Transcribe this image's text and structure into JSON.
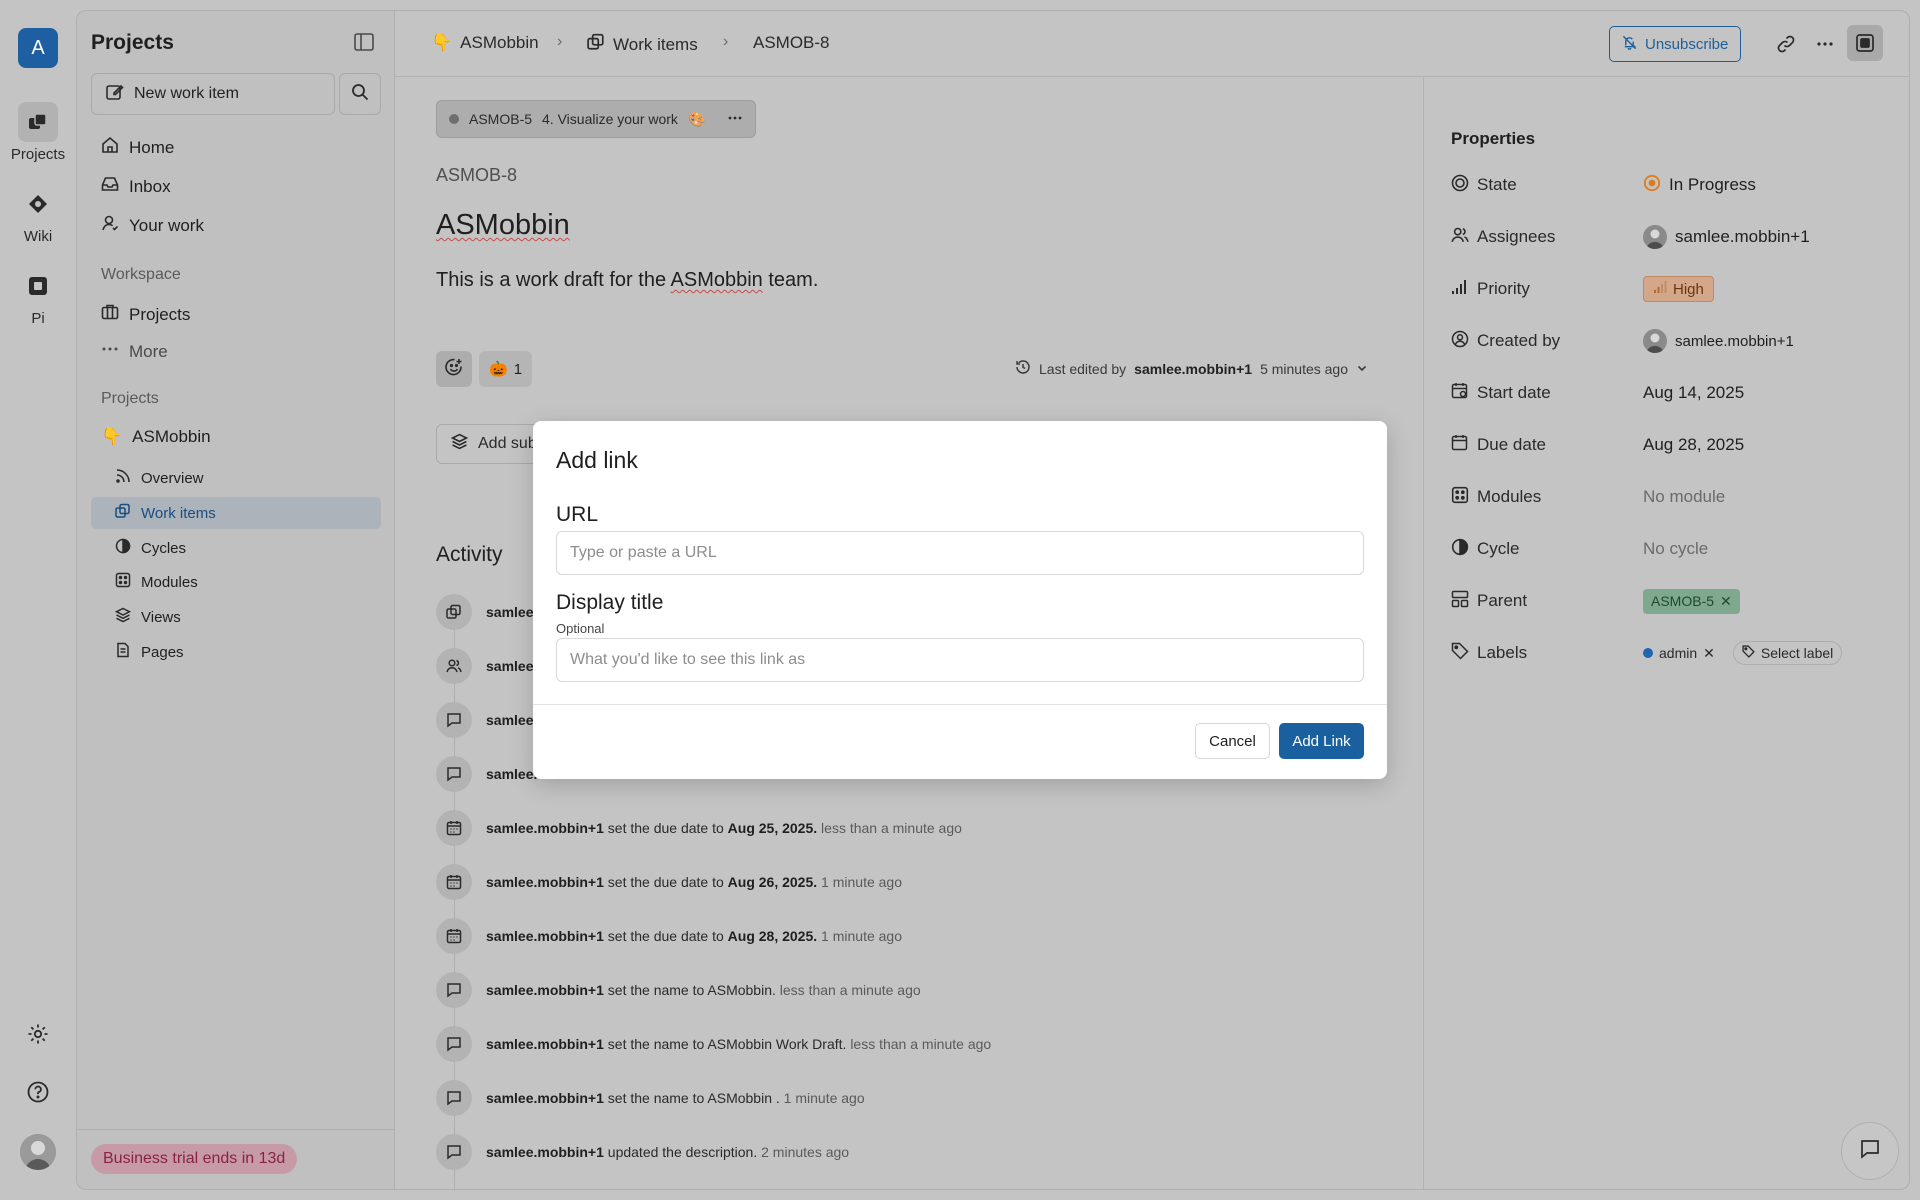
{
  "rail": {
    "workspace_initial": "A",
    "items": [
      {
        "label": "Projects",
        "icon": "projects-icon",
        "active": true
      },
      {
        "label": "Wiki",
        "icon": "wiki-icon"
      },
      {
        "label": "Pi",
        "icon": "pi-icon"
      }
    ]
  },
  "sidebar": {
    "title": "Projects",
    "new_item_label": "New work item",
    "nav": [
      {
        "label": "Home",
        "icon": "home-icon"
      },
      {
        "label": "Inbox",
        "icon": "inbox-icon"
      },
      {
        "label": "Your work",
        "icon": "user-icon"
      }
    ],
    "workspace_heading": "Workspace",
    "workspace_items": [
      {
        "label": "Projects",
        "icon": "briefcase-icon"
      },
      {
        "label": "More",
        "icon": "more-icon"
      }
    ],
    "projects_heading": "Projects",
    "project_name": "ASMobbin",
    "project_emoji": "👇",
    "project_items": [
      {
        "label": "Overview",
        "icon": "rss-icon"
      },
      {
        "label": "Work items",
        "icon": "layers-icon",
        "active": true
      },
      {
        "label": "Cycles",
        "icon": "cycle-icon"
      },
      {
        "label": "Modules",
        "icon": "modules-icon"
      },
      {
        "label": "Views",
        "icon": "views-icon"
      },
      {
        "label": "Pages",
        "icon": "page-icon"
      }
    ],
    "trial_badge": "Business trial ends in 13d"
  },
  "topbar": {
    "breadcrumb": [
      "ASMobbin",
      "Work items",
      "ASMOB-8"
    ],
    "unsubscribe_label": "Unsubscribe"
  },
  "issue": {
    "parent_id": "ASMOB-5",
    "parent_title": "4. Visualize your work",
    "parent_emoji": "🎨",
    "id": "ASMOB-8",
    "title": "ASMobbin",
    "description_before": "This is a work draft for the ",
    "description_highlight": "ASMobbin",
    "description_after": " team.",
    "reaction_emoji": "🎃",
    "reaction_count": "1",
    "last_edited_prefix": "Last edited by",
    "last_edited_user": "samlee.mobbin+1",
    "last_edited_time": "5 minutes ago",
    "add_sub_label": "Add sub-work item"
  },
  "activity": {
    "title": "Activity",
    "partial_rows": [
      {
        "icon": "layers-icon",
        "user": "samlee."
      },
      {
        "icon": "users-icon",
        "user": "samlee."
      },
      {
        "icon": "comment-icon",
        "user": "samlee."
      },
      {
        "icon": "comment-icon",
        "user": "samlee."
      }
    ],
    "rows": [
      {
        "icon": "calendar-icon",
        "user": "samlee.mobbin+1",
        "action": "set the due date to",
        "value": "Aug 25, 2025.",
        "time": "less than a minute ago"
      },
      {
        "icon": "calendar-icon",
        "user": "samlee.mobbin+1",
        "action": "set the due date to",
        "value": "Aug 26, 2025.",
        "time": "1 minute ago"
      },
      {
        "icon": "calendar-icon",
        "user": "samlee.mobbin+1",
        "action": "set the due date to",
        "value": "Aug 28, 2025.",
        "time": "1 minute ago"
      },
      {
        "icon": "comment-icon",
        "user": "samlee.mobbin+1",
        "action": "set the name to ASMobbin.",
        "value": "",
        "time": "less than a minute ago"
      },
      {
        "icon": "comment-icon",
        "user": "samlee.mobbin+1",
        "action": "set the name to ASMobbin Work Draft.",
        "value": "",
        "time": "less than a minute ago"
      },
      {
        "icon": "comment-icon",
        "user": "samlee.mobbin+1",
        "action": "set the name to ASMobbin .",
        "value": "",
        "time": "1 minute ago"
      },
      {
        "icon": "comment-icon",
        "user": "samlee.mobbin+1",
        "action": "updated the description.",
        "value": "",
        "time": "2 minutes ago"
      }
    ]
  },
  "properties": {
    "title": "Properties",
    "state": {
      "label": "State",
      "value": "In Progress"
    },
    "assignees": {
      "label": "Assignees",
      "value": "samlee.mobbin+1"
    },
    "priority": {
      "label": "Priority",
      "value": "High"
    },
    "created_by": {
      "label": "Created by",
      "value": "samlee.mobbin+1"
    },
    "start_date": {
      "label": "Start date",
      "value": "Aug 14, 2025"
    },
    "due_date": {
      "label": "Due date",
      "value": "Aug 28, 2025"
    },
    "modules": {
      "label": "Modules",
      "value": "No module"
    },
    "cycle": {
      "label": "Cycle",
      "value": "No cycle"
    },
    "parent": {
      "label": "Parent",
      "value": "ASMOB-5"
    },
    "labels": {
      "label": "Labels",
      "value": "admin",
      "select_label": "Select label"
    }
  },
  "modal": {
    "title": "Add link",
    "url_label": "URL",
    "url_placeholder": "Type or paste a URL",
    "url_value": "",
    "display_label": "Display title",
    "display_sub": "Optional",
    "display_placeholder": "What you'd like to see this link as",
    "display_value": "",
    "cancel_label": "Cancel",
    "submit_label": "Add Link"
  },
  "colors": {
    "accent": "#1a5f9e",
    "state_in_progress": "#e07a1f",
    "priority_high": "#c2885e",
    "trial_badge": "#8a2340"
  }
}
